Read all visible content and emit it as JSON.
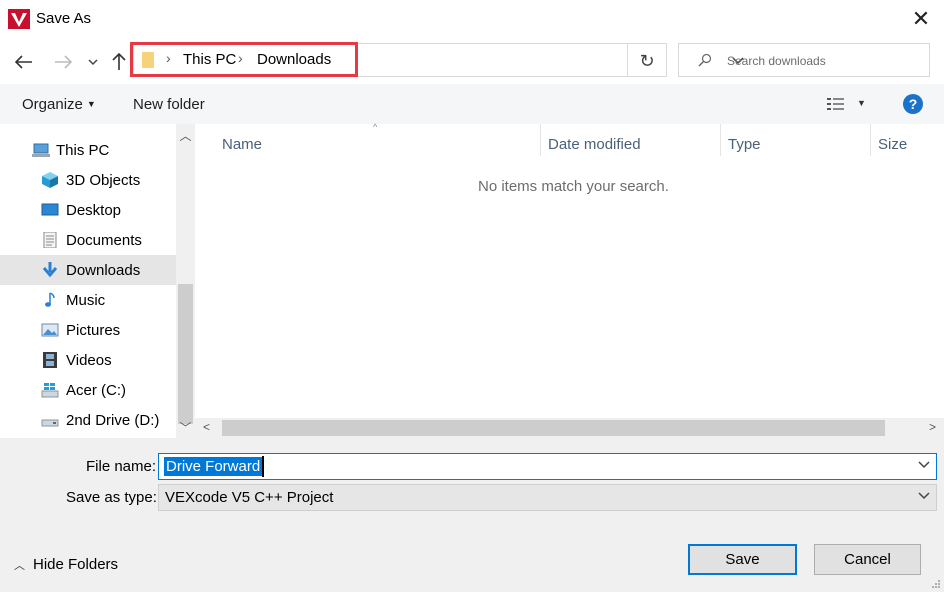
{
  "window": {
    "title": "Save As",
    "close_glyph": "✕",
    "app_icon": "vexcode-v-icon"
  },
  "nav": {
    "back_icon": "arrow-left-icon",
    "forward_icon": "arrow-right-icon",
    "recent_icon": "chevron-down-icon",
    "up_icon": "arrow-up-icon"
  },
  "address": {
    "segments": [
      "This PC",
      "Downloads"
    ],
    "separator": "›",
    "dropdown": "⌄",
    "refresh_glyph": "↻",
    "highlight_color": "#e53944"
  },
  "search": {
    "placeholder": "Search downloads"
  },
  "toolbar": {
    "organize": "Organize",
    "organize_caret": "▼",
    "new_folder": "New folder",
    "view_caret": "▼",
    "help": "?"
  },
  "sidebar": {
    "items": [
      {
        "label": "This PC",
        "icon": "computer-icon",
        "root": true,
        "selected": false
      },
      {
        "label": "3D Objects",
        "icon": "cube-3d-icon",
        "selected": false
      },
      {
        "label": "Desktop",
        "icon": "desktop-icon",
        "selected": false
      },
      {
        "label": "Documents",
        "icon": "document-icon",
        "selected": false
      },
      {
        "label": "Downloads",
        "icon": "download-arrow-icon",
        "selected": true
      },
      {
        "label": "Music",
        "icon": "music-note-icon",
        "selected": false
      },
      {
        "label": "Pictures",
        "icon": "picture-icon",
        "selected": false
      },
      {
        "label": "Videos",
        "icon": "film-icon",
        "selected": false
      },
      {
        "label": "Acer (C:)",
        "icon": "windows-drive-icon",
        "selected": false
      },
      {
        "label": "2nd Drive (D:)",
        "icon": "drive-icon",
        "selected": false
      }
    ]
  },
  "filelist": {
    "columns": [
      "Name",
      "Date modified",
      "Type",
      "Size"
    ],
    "empty_message": "No items match your search.",
    "sort_glyph": "^"
  },
  "scroll": {
    "up": "︿",
    "down": "﹀",
    "left": "<",
    "right": ">"
  },
  "form": {
    "filename_label": "File name:",
    "filename_value": "Drive Forward",
    "type_label": "Save as type:",
    "type_value": "VEXcode V5 C++ Project",
    "dropdown_glyph": "⌄"
  },
  "footer": {
    "hide_folders": "Hide Folders",
    "hide_chevron": "︿",
    "save": "Save",
    "cancel": "Cancel"
  },
  "colors": {
    "accent": "#0078d7",
    "help": "#1a73c8",
    "header_text": "#4c607a",
    "muted": "#6d6d6d"
  }
}
